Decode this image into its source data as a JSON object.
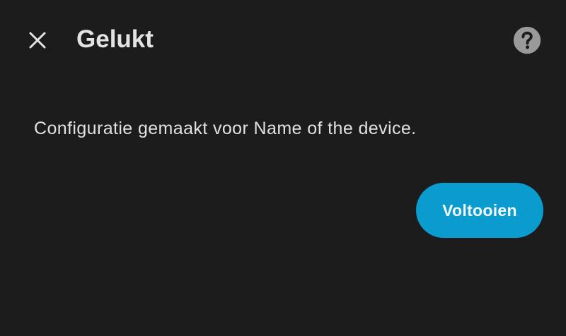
{
  "dialog": {
    "title": "Gelukt",
    "close_icon": "close-icon",
    "help_icon": "help-circle-icon",
    "message": "Configuratie gemaakt voor Name of the device.",
    "finish_label": "Voltooien"
  },
  "colors": {
    "background": "#1c1c1d",
    "text": "#e3e3e3",
    "accent": "#0a9bcf",
    "help_icon": "#9a9a9a"
  }
}
